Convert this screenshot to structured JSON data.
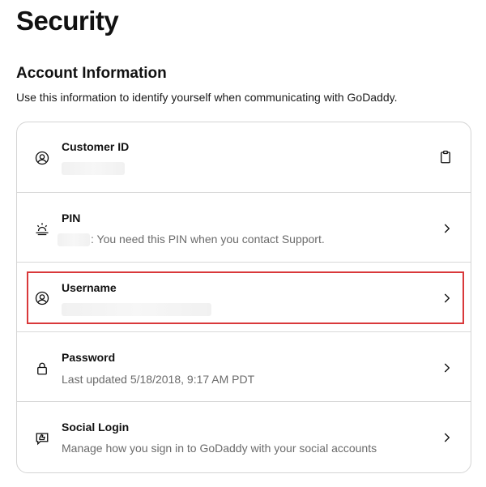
{
  "page": {
    "title": "Security"
  },
  "section": {
    "title": "Account Information",
    "description": "Use this information to identify yourself when communicating with GoDaddy."
  },
  "rows": [
    {
      "title": "Customer ID",
      "subtitle": "",
      "icon": "user-circle-icon",
      "action_icon": "clipboard-icon"
    },
    {
      "title": "PIN",
      "subtitle": ": You need this PIN when you contact Support.",
      "icon": "sunrise-icon",
      "action_icon": "chevron-right-icon"
    },
    {
      "title": "Username",
      "subtitle": "",
      "icon": "user-circle-icon",
      "action_icon": "chevron-right-icon",
      "highlighted": true
    },
    {
      "title": "Password",
      "subtitle": "Last updated 5/18/2018, 9:17 AM PDT",
      "icon": "lock-icon",
      "action_icon": "chevron-right-icon"
    },
    {
      "title": "Social Login",
      "subtitle": "Manage how you sign in to GoDaddy with your social accounts",
      "icon": "thumbs-up-chat-icon",
      "action_icon": "chevron-right-icon"
    }
  ],
  "colors": {
    "highlight": "#d9383a",
    "border": "#d4d4d4",
    "muted_text": "#6b6b6b"
  }
}
